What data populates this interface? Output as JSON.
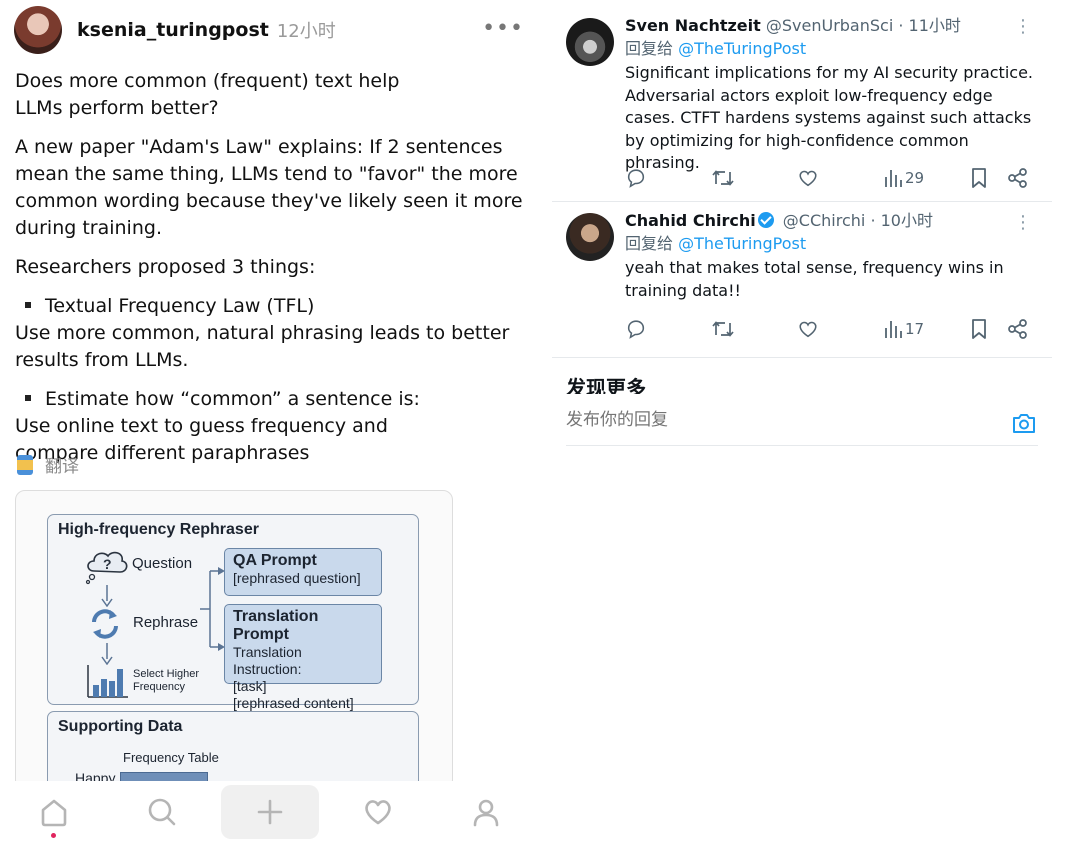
{
  "left_post": {
    "username": "ksenia_turingpost",
    "time": "12小时",
    "more": "•••",
    "paragraphs": [
      "Does more common (frequent) text help LLMs perform better?",
      "A new paper \"Adam's Law\" explains: If 2 sentences mean the same thing, LLMs tend to \"favor\" the more common wording because they've likely seen it more during training.",
      "Researchers proposed 3 things:"
    ],
    "bullets": [
      {
        "title": "Textual Frequency Law (TFL)",
        "detail": "Use more common, natural phrasing leads to better results from LLMs."
      },
      {
        "title": "Estimate how “common” a sentence is:",
        "detail": "Use online text to guess frequency and compare different paraphrases"
      }
    ],
    "translate_label": "翻译",
    "figure": {
      "section1_title": "High-frequency Rephraser",
      "question_label": "Question",
      "rephrase_label": "Rephrase",
      "select_label_1": "Select Higher",
      "select_label_2": "Frequency",
      "qa_prompt_title": "QA Prompt",
      "qa_prompt_line": "[rephrased question]",
      "translation_prompt_title": "Translation Prompt",
      "translation_prompt_lines": [
        "Translation Instruction:",
        "[task]",
        "[rephrased content]"
      ],
      "section2_title": "Supporting Data",
      "freq_table_label": "Frequency Table",
      "freq_row_label": "Happy"
    }
  },
  "tabbar": {
    "items": [
      "home-icon",
      "search-icon",
      "plus-icon",
      "heart-icon",
      "profile-icon"
    ]
  },
  "replies": [
    {
      "name": "Sven Nachtzeit",
      "handle": "@SvenUrbanSci",
      "time": "· 11小时",
      "reply_prefix": "回复给",
      "reply_to": "@TheTuringPost",
      "text": "Significant implications for my AI security practice. Adversarial actors exploit low-frequency edge cases. CTFT hardens systems against such attacks by optimizing for high-confidence common phrasing.",
      "views": "29",
      "verified": false
    },
    {
      "name": "Chahid Chirchi",
      "handle": "@CChirchi",
      "time": "· 10小时",
      "reply_prefix": "回复给",
      "reply_to": "@TheTuringPost",
      "text": "yeah that makes total sense, frequency wins in training data!!",
      "views": "17",
      "verified": true
    }
  ],
  "discover_title": "发现更多",
  "compose": {
    "placeholder": "发布你的回复"
  },
  "colors": {
    "accent": "#1d9bf0",
    "muted": "#536471",
    "badge_dot": "#e0245e"
  }
}
